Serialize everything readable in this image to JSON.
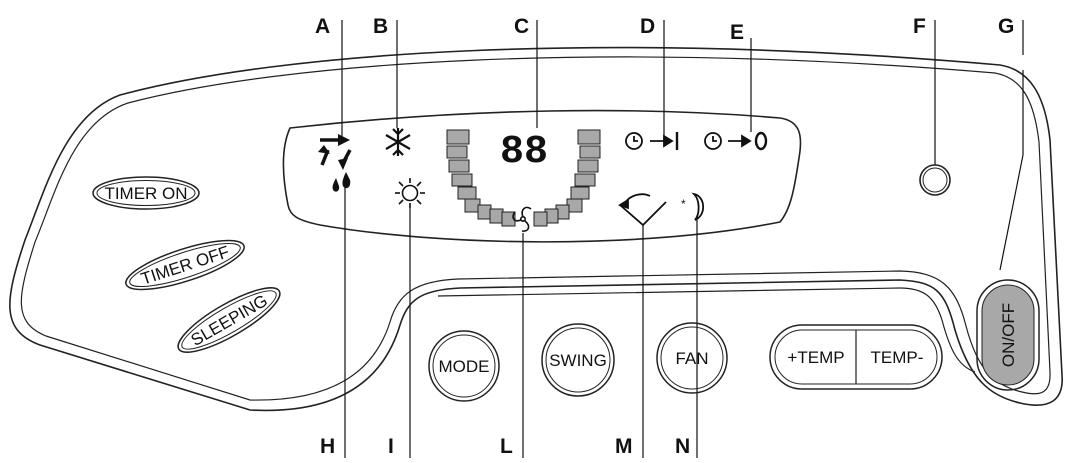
{
  "callouts": {
    "a": "A",
    "b": "B",
    "c": "C",
    "d": "D",
    "e": "E",
    "f": "F",
    "g": "G",
    "h": "H",
    "i": "I",
    "l": "L",
    "m": "M",
    "n": "N"
  },
  "display": {
    "digits": "88"
  },
  "buttons": {
    "timer_on": "TIMER ON",
    "timer_off": "TIMER OFF",
    "sleeping": "SLEEPING",
    "mode": "MODE",
    "swing": "SWING",
    "fan": "FAN",
    "temp_plus": "+TEMP",
    "temp_minus": "TEMP-",
    "on_off": "ON/OFF"
  },
  "icons": [
    "cool-cycle-icon",
    "snowflake-icon",
    "timer-on-icon",
    "timer-off-icon",
    "indicator-lamp-icon",
    "dry-drops-icon",
    "sun-heat-icon",
    "fan-icon",
    "swing-icon",
    "sleep-moon-icon"
  ],
  "colors": {
    "segment_fill": "#a8a8a8",
    "button_active_fill": "#a8a8a8",
    "outline": "#222222"
  }
}
